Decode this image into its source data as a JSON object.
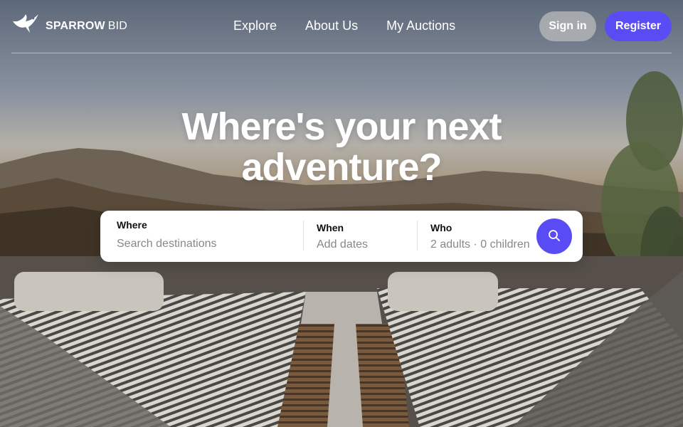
{
  "brand": {
    "name_bold": "SPARROW",
    "name_light": "BID",
    "logo_icon": "bird-icon"
  },
  "nav": {
    "links": [
      {
        "label": "Explore"
      },
      {
        "label": "About Us"
      },
      {
        "label": "My Auctions"
      }
    ],
    "signin_label": "Sign in",
    "register_label": "Register"
  },
  "hero": {
    "headline_line1": "Where's your next",
    "headline_line2": "adventure?"
  },
  "search": {
    "where": {
      "label": "Where",
      "placeholder": "Search destinations"
    },
    "when": {
      "label": "When",
      "placeholder": "Add dates"
    },
    "who": {
      "label": "Who",
      "value": "2 adults · 0 children"
    },
    "button_icon": "search-icon"
  },
  "colors": {
    "accent": "#5a4cf5",
    "text_muted": "#888888"
  }
}
